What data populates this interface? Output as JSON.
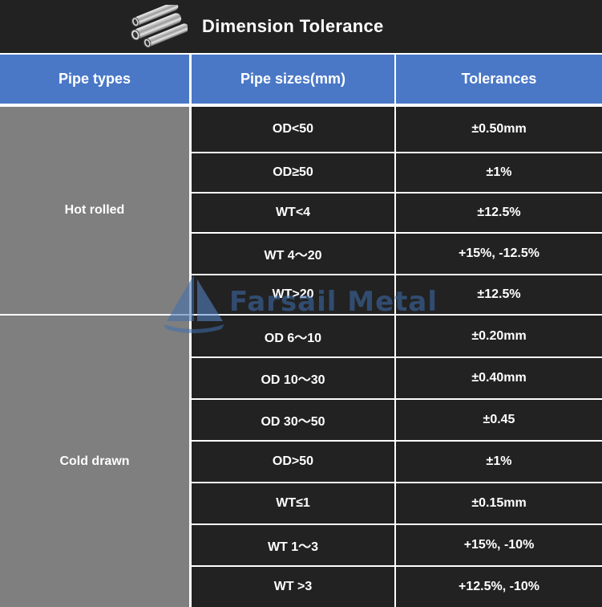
{
  "title": "Dimension Tolerance",
  "icon": "pipes-icon",
  "watermark": "Farsail Metal",
  "headers": [
    "Pipe types",
    "Pipe sizes(mm)",
    "Tolerances"
  ],
  "groups": [
    {
      "type": "Hot rolled",
      "rows": [
        {
          "size": "OD<50",
          "tolerance": "±0.50mm"
        },
        {
          "size": "OD≥50",
          "tolerance": "±1%"
        },
        {
          "size": "WT<4",
          "tolerance": "±12.5%"
        },
        {
          "size": "WT 4～20",
          "tolerance": "+15%, -12.5%"
        },
        {
          "size": "WT>20",
          "tolerance": "±12.5%"
        }
      ]
    },
    {
      "type": "Cold drawn",
      "rows": [
        {
          "size": "OD 6～10",
          "tolerance": "±0.20mm"
        },
        {
          "size": "OD 10～30",
          "tolerance": "±0.40mm"
        },
        {
          "size": "OD 30～50",
          "tolerance": "±0.45"
        },
        {
          "size": "OD>50",
          "tolerance": "±1%"
        },
        {
          "size": "WT≤1",
          "tolerance": "±0.15mm"
        },
        {
          "size": "WT 1～3",
          "tolerance": "+15%, -10%"
        },
        {
          "size": "WT >3",
          "tolerance": "+12.5%, -10%"
        }
      ]
    }
  ],
  "colors": {
    "title_bg": "#222222",
    "header_bg": "#4a78c7",
    "type_bg": "#7f7f7f",
    "cell_bg": "#222222",
    "text": "#ffffff"
  }
}
